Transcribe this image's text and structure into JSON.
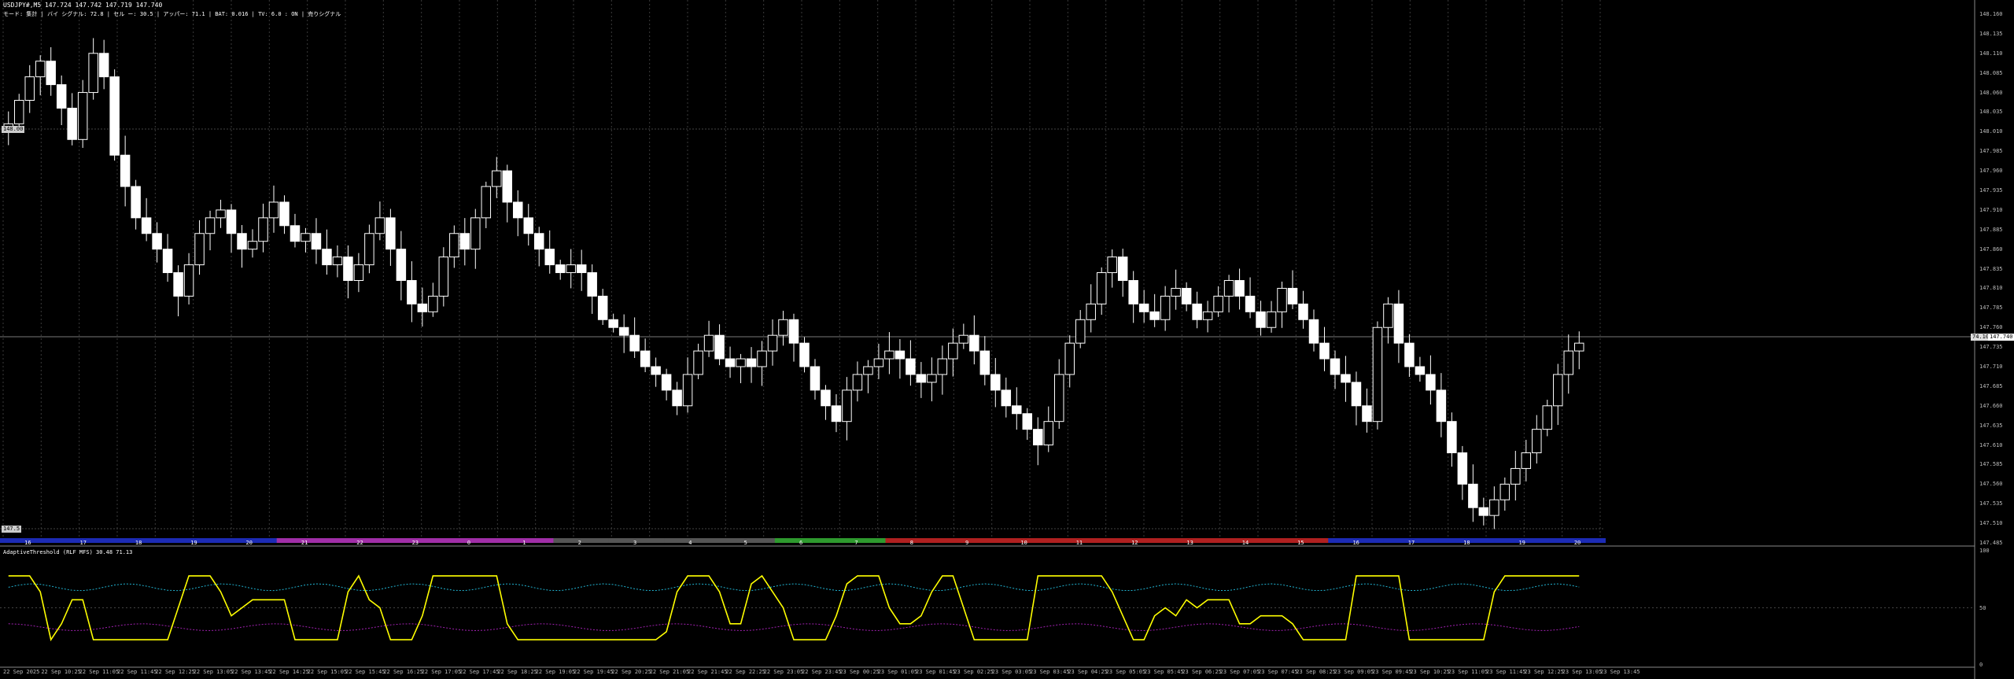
{
  "header": {
    "symbol_line": "USDJPY#,M5  147.724 147.742 147.719 147.740",
    "status_line": "モード: 集計 | バイ シグナル: 72.8 | セル ー: 30.5 | アッパー: 71.1 | BAT: 0.016 | TV: 6.0 : ON | 売りシグナル"
  },
  "indicator_label": "AdaptiveThreshold (RLF MFS) 30.48 71.13",
  "price_axis": [
    "148.160",
    "148.135",
    "148.110",
    "148.085",
    "148.060",
    "148.035",
    "148.010",
    "147.985",
    "147.960",
    "147.935",
    "147.910",
    "147.885",
    "147.860",
    "147.835",
    "147.810",
    "147.785",
    "147.760",
    "147.735",
    "147.710",
    "147.685",
    "147.660",
    "147.635",
    "147.610",
    "147.585",
    "147.560",
    "147.535",
    "147.510",
    "147.485"
  ],
  "indicator_axis": [
    "100",
    "50",
    "0"
  ],
  "left_tags": {
    "upper": "148.00",
    "lower": "147.5"
  },
  "current_price_tag": "147.740",
  "right_marker": "74.10",
  "time_axis": [
    "22 Sep 2025",
    "22 Sep 10:25",
    "22 Sep 11:05",
    "22 Sep 11:45",
    "22 Sep 12:25",
    "22 Sep 13:05",
    "22 Sep 13:45",
    "22 Sep 14:25",
    "22 Sep 15:05",
    "22 Sep 15:45",
    "22 Sep 16:25",
    "22 Sep 17:05",
    "22 Sep 17:45",
    "22 Sep 18:25",
    "22 Sep 19:05",
    "22 Sep 19:45",
    "22 Sep 20:25",
    "22 Sep 21:05",
    "22 Sep 21:45",
    "22 Sep 22:25",
    "22 Sep 23:05",
    "22 Sep 23:45",
    "23 Sep 00:25",
    "23 Sep 01:05",
    "23 Sep 01:45",
    "23 Sep 02:25",
    "23 Sep 03:05",
    "23 Sep 03:45",
    "23 Sep 04:25",
    "23 Sep 05:05",
    "23 Sep 05:45",
    "23 Sep 06:25",
    "23 Sep 07:05",
    "23 Sep 07:45",
    "23 Sep 08:25",
    "23 Sep 09:05",
    "23 Sep 09:45",
    "23 Sep 10:25",
    "23 Sep 11:05",
    "23 Sep 11:45",
    "23 Sep 12:25",
    "23 Sep 13:05",
    "23 Sep 13:45"
  ],
  "hour_bar": [
    {
      "label": "16",
      "color": "#1c2bb5"
    },
    {
      "label": "17",
      "color": "#1c2bb5"
    },
    {
      "label": "18",
      "color": "#1c2bb5"
    },
    {
      "label": "19",
      "color": "#1c2bb5"
    },
    {
      "label": "20",
      "color": "#1c2bb5"
    },
    {
      "label": "21",
      "color": "#a12ea8"
    },
    {
      "label": "22",
      "color": "#a12ea8"
    },
    {
      "label": "23",
      "color": "#a12ea8"
    },
    {
      "label": "0",
      "color": "#a12ea8"
    },
    {
      "label": "1",
      "color": "#a12ea8"
    },
    {
      "label": "2",
      "color": "#555555"
    },
    {
      "label": "3",
      "color": "#555555"
    },
    {
      "label": "4",
      "color": "#555555"
    },
    {
      "label": "5",
      "color": "#555555"
    },
    {
      "label": "6",
      "color": "#2e9a2e"
    },
    {
      "label": "7",
      "color": "#2e9a2e"
    },
    {
      "label": "8",
      "color": "#b02020"
    },
    {
      "label": "9",
      "color": "#b02020"
    },
    {
      "label": "10",
      "color": "#b02020"
    },
    {
      "label": "11",
      "color": "#b02020"
    },
    {
      "label": "12",
      "color": "#b02020"
    },
    {
      "label": "13",
      "color": "#b02020"
    },
    {
      "label": "14",
      "color": "#b02020"
    },
    {
      "label": "15",
      "color": "#b02020"
    },
    {
      "label": "16",
      "color": "#1c2bb5"
    },
    {
      "label": "17",
      "color": "#1c2bb5"
    },
    {
      "label": "18",
      "color": "#1c2bb5"
    },
    {
      "label": "19",
      "color": "#1c2bb5"
    },
    {
      "label": "20",
      "color": "#1c2bb5"
    }
  ],
  "colors": {
    "background": "#000000",
    "candle": "#ffffff",
    "grid": "#3a3a3a",
    "indicator": "#ffff00",
    "upper_band": "#20b2d0",
    "lower_band": "#a020b0",
    "oversold": "#ff40ff",
    "overbought": "#40ffff"
  },
  "chart_data": {
    "type": "candlestick",
    "symbol": "USDJPY#",
    "timeframe": "M5",
    "y_range": [
      147.485,
      148.16
    ],
    "close_series": [
      148.02,
      148.05,
      148.08,
      148.1,
      148.07,
      148.04,
      148.0,
      148.06,
      148.11,
      148.08,
      147.98,
      147.94,
      147.9,
      147.88,
      147.86,
      147.83,
      147.8,
      147.84,
      147.88,
      147.9,
      147.91,
      147.88,
      147.86,
      147.87,
      147.9,
      147.92,
      147.89,
      147.87,
      147.88,
      147.86,
      147.84,
      147.85,
      147.82,
      147.84,
      147.88,
      147.9,
      147.86,
      147.82,
      147.79,
      147.78,
      147.8,
      147.85,
      147.88,
      147.86,
      147.9,
      147.94,
      147.96,
      147.92,
      147.9,
      147.88,
      147.86,
      147.84,
      147.83,
      147.84,
      147.83,
      147.8,
      147.77,
      147.76,
      147.75,
      147.73,
      147.71,
      147.7,
      147.68,
      147.66,
      147.7,
      147.73,
      147.75,
      147.72,
      147.71,
      147.72,
      147.71,
      147.73,
      147.75,
      147.77,
      147.74,
      147.71,
      147.68,
      147.66,
      147.64,
      147.68,
      147.7,
      147.71,
      147.72,
      147.73,
      147.72,
      147.7,
      147.69,
      147.7,
      147.72,
      147.74,
      147.75,
      147.73,
      147.7,
      147.68,
      147.66,
      147.65,
      147.63,
      147.61,
      147.64,
      147.7,
      147.74,
      147.77,
      147.79,
      147.83,
      147.85,
      147.82,
      147.79,
      147.78,
      147.77,
      147.8,
      147.81,
      147.79,
      147.77,
      147.78,
      147.8,
      147.82,
      147.8,
      147.78,
      147.76,
      147.78,
      147.81,
      147.79,
      147.77,
      147.74,
      147.72,
      147.7,
      147.69,
      147.66,
      147.64,
      147.76,
      147.79,
      147.74,
      147.71,
      147.7,
      147.68,
      147.64,
      147.6,
      147.56,
      147.53,
      147.52,
      147.54,
      147.56,
      147.58,
      147.6,
      147.63,
      147.66,
      147.7,
      147.73,
      147.74
    ]
  }
}
